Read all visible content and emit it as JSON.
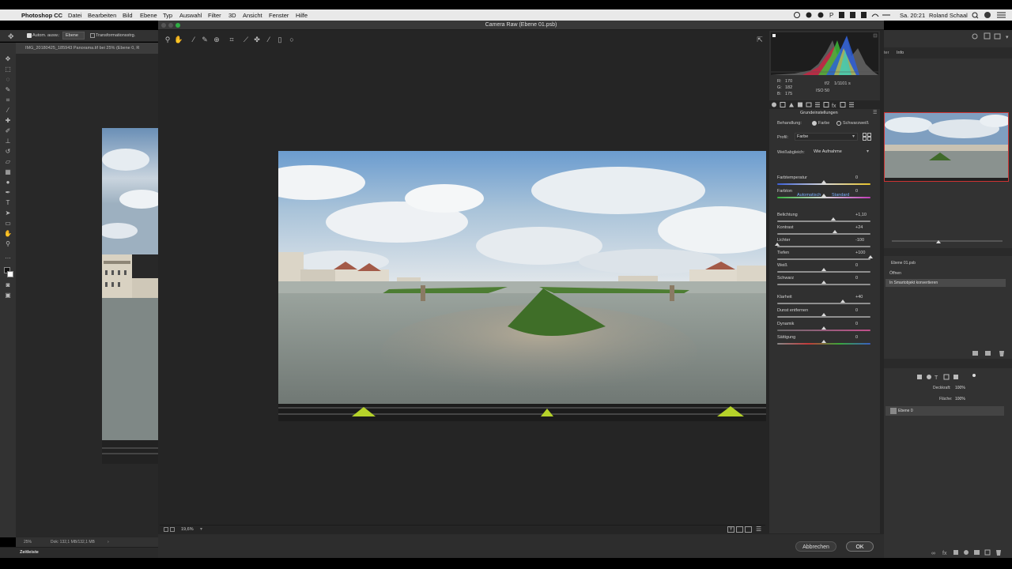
{
  "menubar": {
    "app": "Photoshop CC",
    "items": [
      "Datei",
      "Bearbeiten",
      "Bild",
      "Ebene",
      "Typ",
      "Auswahl",
      "Filter",
      "3D",
      "Ansicht",
      "Fenster",
      "Hilfe"
    ],
    "clock": "Sa. 20:21",
    "user": "Roland Schaal"
  },
  "ps_options": {
    "auto_select_label": "Autom. ausw.:",
    "auto_select_value": "Ebene",
    "transform_label": "Transformationsstrg."
  },
  "ps_document": {
    "tab_title": "IMG_20180425_185943 Panorama.tif bei 25% (Ebene 0, R",
    "zoom": "25%",
    "doc_info": "Dok: 132,1 MB/132,1 MB",
    "timeline_label": "Zeitleiste"
  },
  "ps_right": {
    "tab_info": "Info",
    "tab_partial": "ter",
    "history_file": "Ebene 01.psb",
    "history_items": [
      "Öffnen",
      "In Smartobjekt konvertieren"
    ],
    "opacity_label": "Deckkraft:",
    "opacity_value": "100%",
    "fill_label": "Fläche:",
    "fill_value": "100%",
    "layer_name": "Ebene 0"
  },
  "camera_raw": {
    "title": "Camera Raw (Ebene 01.psb)",
    "zoom": "19,6%",
    "cancel_label": "Abbrechen",
    "ok_label": "OK",
    "readout": {
      "r_label": "R:",
      "r_value": "170",
      "g_label": "G:",
      "g_value": "182",
      "b_label": "B:",
      "b_value": "175",
      "aperture": "f/2",
      "shutter": "1/1101 s",
      "iso": "ISO 50"
    },
    "panel": {
      "section_title": "Grundeinstellungen",
      "treatment_label": "Behandlung:",
      "treatment_color": "Farbe",
      "treatment_bw": "Schwarzweiß",
      "profile_label": "Profil:",
      "profile_value": "Farbe",
      "wb_label": "Weißabgleich:",
      "wb_value": "Wie Aufnahme",
      "auto_label": "Automatisch",
      "default_label": "Standard",
      "sliders": [
        {
          "name": "Farbtemperatur",
          "value": "0",
          "pos": 0.5
        },
        {
          "name": "Farbton",
          "value": "0",
          "pos": 0.5
        },
        {
          "name": "Belichtung",
          "value": "+1,10",
          "pos": 0.6
        },
        {
          "name": "Kontrast",
          "value": "+24",
          "pos": 0.62
        },
        {
          "name": "Lichter",
          "value": "-100",
          "pos": 0.0
        },
        {
          "name": "Tiefen",
          "value": "+100",
          "pos": 1.0
        },
        {
          "name": "Weiß",
          "value": "0",
          "pos": 0.5
        },
        {
          "name": "Schwarz",
          "value": "0",
          "pos": 0.5
        },
        {
          "name": "Klarheit",
          "value": "+40",
          "pos": 0.7
        },
        {
          "name": "Dunst entfernen",
          "value": "0",
          "pos": 0.5
        },
        {
          "name": "Dynamik",
          "value": "0",
          "pos": 0.5
        },
        {
          "name": "Sättigung",
          "value": "0",
          "pos": 0.5
        }
      ]
    }
  },
  "colors": {
    "accent_blue": "#2f6fd6",
    "dialog_bg": "#252525",
    "panel_bg": "#303030"
  }
}
